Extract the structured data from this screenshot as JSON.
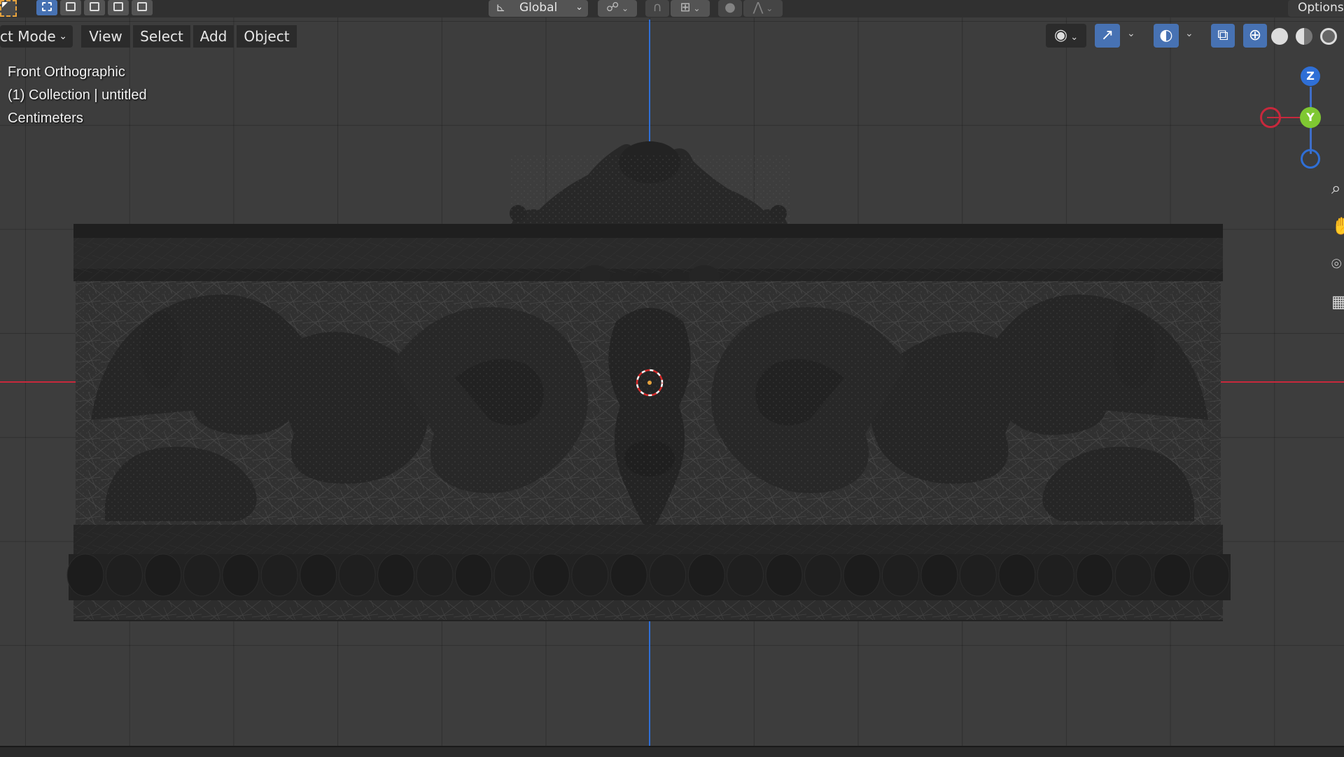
{
  "header": {
    "orientation_label": "Global",
    "options_label": "Options"
  },
  "menu": {
    "mode_label": "ct Mode",
    "view_label": "View",
    "select_label": "Select",
    "add_label": "Add",
    "object_label": "Object"
  },
  "overlay": {
    "view_name": "Front Orthographic",
    "collection_line": "(1) Collection | untitled",
    "units": "Centimeters"
  },
  "gizmo": {
    "z_label": "Z",
    "y_label": "Y"
  },
  "colors": {
    "x_axis": "#c8283c",
    "z_axis": "#2f6fd6",
    "y_axis": "#7fc832",
    "accent_blue": "#4772b3",
    "cursor_orange": "#e8a33d"
  },
  "icons": {
    "select_box_modes": [
      "select-set-icon",
      "select-extend-icon",
      "select-subtract-icon",
      "select-invert-icon",
      "select-intersect-icon"
    ],
    "header_right": [
      "visibility-eye-icon",
      "gizmo-arrow-icon",
      "overlay-icon",
      "xray-icon",
      "wireframe-shading-icon",
      "solid-shading-icon",
      "material-shading-icon",
      "rendered-shading-icon"
    ],
    "nav_tools": [
      "zoom-magnifier-icon",
      "pan-hand-icon",
      "camera-icon",
      "grid-ortho-icon"
    ]
  }
}
